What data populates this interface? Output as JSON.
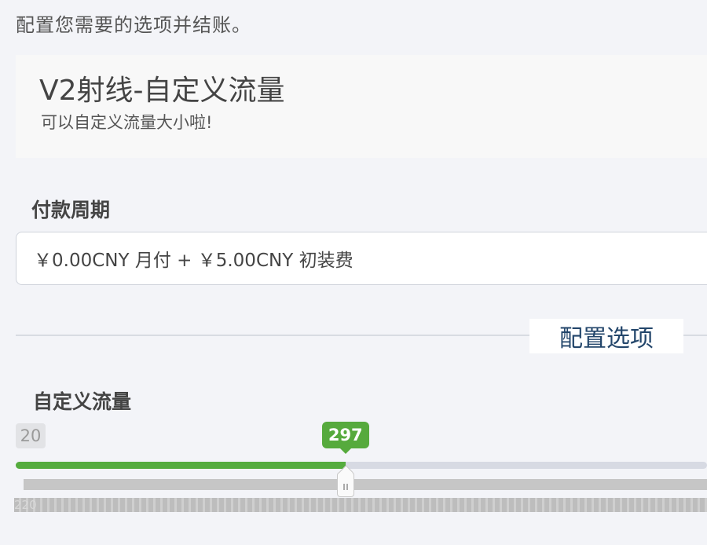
{
  "page": {
    "intro": "配置您需要的选项并结账。"
  },
  "product": {
    "name": "V2射线-自定义流量",
    "tagline": "可以自定义流量大小啦!"
  },
  "billing": {
    "label": "付款周期",
    "selected": "￥0.00CNY 月付 + ￥5.00CNY 初装费"
  },
  "options": {
    "heading": "配置选项"
  },
  "traffic": {
    "label": "自定义流量",
    "min_label": "20",
    "value_label": "297",
    "min": 20,
    "value": 297,
    "fill_fraction": 0.477,
    "tick_text": "220"
  },
  "colors": {
    "accent_green": "#56aa3d",
    "heading_blue": "#23466b"
  }
}
